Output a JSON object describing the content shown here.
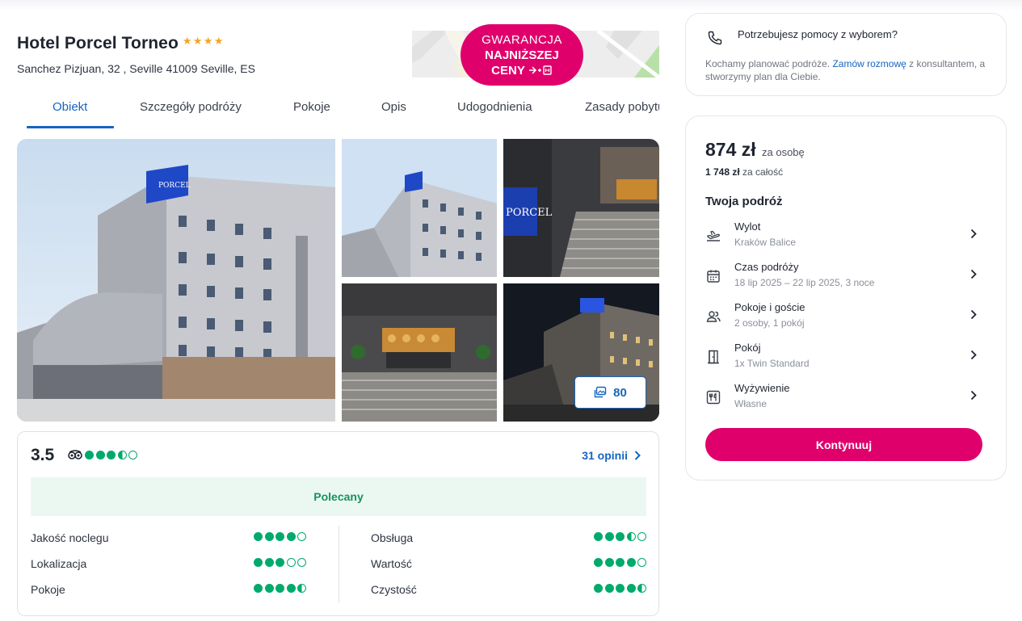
{
  "hotel": {
    "name": "Hotel Porcel Torneo",
    "stars": 4,
    "address": "Sanchez Pizjuan, 32 , Seville 41009 Seville, ES"
  },
  "promo_badge": {
    "line1": "GWARANCJA",
    "line2": "NAJNIŻSZEJ",
    "line3": "CENY",
    "icon": "plane-plus-hotel-icon",
    "color": "#e0006c"
  },
  "tabs": [
    {
      "label": "Obiekt",
      "active": true
    },
    {
      "label": "Szczegóły podróży",
      "active": false
    },
    {
      "label": "Pokoje",
      "active": false
    },
    {
      "label": "Opis",
      "active": false
    },
    {
      "label": "Udogodnienia",
      "active": false
    },
    {
      "label": "Zasady pobytu",
      "active": false
    }
  ],
  "gallery": {
    "photo_count": "80",
    "photo_icon": "images-icon"
  },
  "reviews": {
    "score": "3.5",
    "provider_icon": "tripadvisor-icon",
    "rating_dots": 3.5,
    "opinions_label": "31 opinii",
    "recommendation": "Polecany",
    "criteria_left": [
      {
        "label": "Jakość noclegu",
        "rating": 4
      },
      {
        "label": "Lokalizacja",
        "rating": 3
      },
      {
        "label": "Pokoje",
        "rating": 4.5
      }
    ],
    "criteria_right": [
      {
        "label": "Obsługa",
        "rating": 3.5
      },
      {
        "label": "Wartość",
        "rating": 4
      },
      {
        "label": "Czystość",
        "rating": 4.5
      }
    ]
  },
  "help": {
    "title": "Potrzebujesz pomocy z wyborem?",
    "text_before": "Kochamy planować podróże. ",
    "link": "Zamów rozmowę",
    "text_after": " z konsultantem, a stworzymy plan dla Ciebie.",
    "icon": "phone-icon"
  },
  "booking": {
    "price": "874 zł",
    "per_person": "za osobę",
    "total_amount": "1 748 zł",
    "total_label": "za całość",
    "trip_heading": "Twoja podróż",
    "rows": [
      {
        "label": "Wylot",
        "value": "Kraków Balice",
        "icon": "plane-departure-icon"
      },
      {
        "label": "Czas podróży",
        "value": "18 lip 2025 – 22 lip 2025, 3 noce",
        "icon": "calendar-icon"
      },
      {
        "label": "Pokoje i goście",
        "value": "2 osoby, 1 pokój",
        "icon": "guests-icon"
      },
      {
        "label": "Pokój",
        "value": "1x Twin Standard",
        "icon": "door-icon"
      },
      {
        "label": "Wyżywienie",
        "value": "Własne",
        "icon": "cutlery-icon"
      }
    ],
    "cta": "Kontynuuj",
    "cta_color": "#e0006c"
  },
  "colors": {
    "accent_blue": "#1565c0",
    "tripadvisor_green": "#00aa6c",
    "recommend_bg": "#ebf8f2"
  }
}
